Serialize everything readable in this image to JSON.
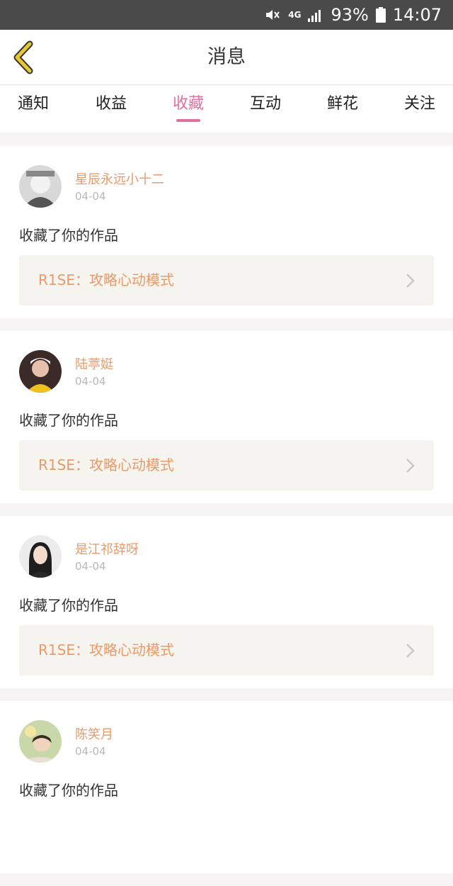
{
  "status_bar": {
    "network": "4G",
    "battery": "93%",
    "time": "14:07"
  },
  "header": {
    "title": "消息"
  },
  "tabs": [
    {
      "label": "通知",
      "active": false
    },
    {
      "label": "收益",
      "active": false
    },
    {
      "label": "收藏",
      "active": true
    },
    {
      "label": "互动",
      "active": false
    },
    {
      "label": "鲜花",
      "active": false
    },
    {
      "label": "关注",
      "active": false
    }
  ],
  "messages": [
    {
      "user": "星辰永远小十二",
      "date": "04-04",
      "action": "收藏了你的作品",
      "work": "R1SE：攻略心动模式"
    },
    {
      "user": "陆葶娗",
      "date": "04-04",
      "action": "收藏了你的作品",
      "work": "R1SE：攻略心动模式"
    },
    {
      "user": "是江祁辞呀",
      "date": "04-04",
      "action": "收藏了你的作品",
      "work": "R1SE：攻略心动模式"
    },
    {
      "user": "陈笑月",
      "date": "04-04",
      "action": "收藏了你的作品",
      "work": ""
    }
  ],
  "colors": {
    "accent": "#e070a0",
    "username": "#e99a6a",
    "back_arrow": "#e8c830"
  }
}
